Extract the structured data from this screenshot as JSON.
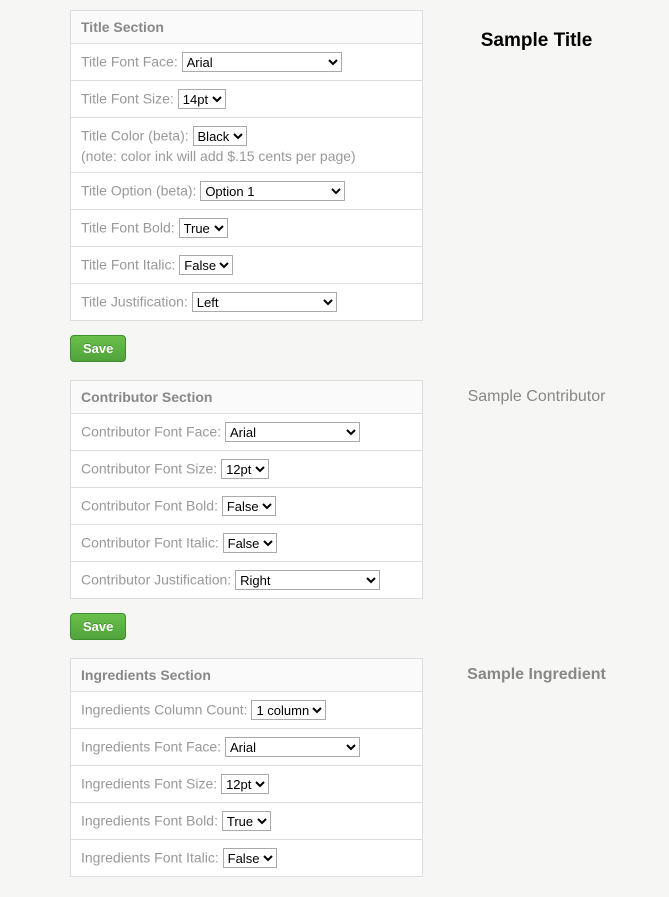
{
  "buttons": {
    "save": "Save"
  },
  "title_section": {
    "header": "Title Section",
    "preview": "Sample Title",
    "font_face": {
      "label": "Title Font Face:",
      "value": "Arial"
    },
    "font_size": {
      "label": "Title Font Size:",
      "value": "14pt"
    },
    "color": {
      "label": "Title Color (beta):",
      "value": "Black",
      "note": "(note: color ink will add $.15 cents per page)"
    },
    "option": {
      "label": "Title Option (beta):",
      "value": "Option 1"
    },
    "font_bold": {
      "label": "Title Font Bold:",
      "value": "True"
    },
    "font_italic": {
      "label": "Title Font Italic:",
      "value": "False"
    },
    "justification": {
      "label": "Title Justification:",
      "value": "Left"
    }
  },
  "contributor_section": {
    "header": "Contributor Section",
    "preview": "Sample Contributor",
    "font_face": {
      "label": "Contributor Font Face:",
      "value": "Arial"
    },
    "font_size": {
      "label": "Contributor Font Size:",
      "value": "12pt"
    },
    "font_bold": {
      "label": "Contributor Font Bold:",
      "value": "False"
    },
    "font_italic": {
      "label": "Contributor Font Italic:",
      "value": "False"
    },
    "justification": {
      "label": "Contributor Justification:",
      "value": "Right"
    }
  },
  "ingredients_section": {
    "header": "Ingredients Section",
    "preview": "Sample Ingredient",
    "column_count": {
      "label": "Ingredients Column Count:",
      "value": "1 column"
    },
    "font_face": {
      "label": "Ingredients Font Face:",
      "value": "Arial"
    },
    "font_size": {
      "label": "Ingredients Font Size:",
      "value": "12pt"
    },
    "font_bold": {
      "label": "Ingredients Font Bold:",
      "value": "True"
    },
    "font_italic": {
      "label": "Ingredients Font Italic:",
      "value": "False"
    }
  }
}
